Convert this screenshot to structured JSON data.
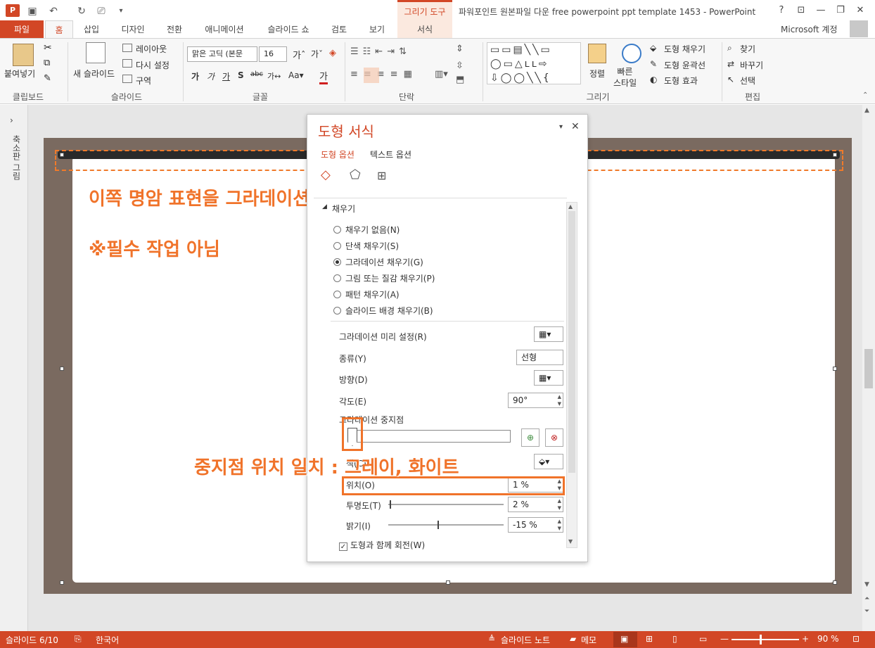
{
  "app": {
    "window_title": "파워포인트 원본파일 다운 free powerpoint ppt template 1453 - PowerPoint",
    "contextual_group": "그리기 도구",
    "account": "Microsoft 계정"
  },
  "tabs": [
    "파일",
    "홈",
    "삽입",
    "디자인",
    "전환",
    "애니메이션",
    "슬라이드 쇼",
    "검토",
    "보기",
    "서식"
  ],
  "ribbon": {
    "clipboard": {
      "paste": "붙여넣기",
      "group": "클립보드"
    },
    "slides": {
      "new_slide": "새 슬라이드",
      "layout": "레이아웃",
      "reset": "다시 설정",
      "section": "구역",
      "group": "슬라이드"
    },
    "font": {
      "font_name": "맑은 고딕 (본문",
      "font_size": "16",
      "group": "글꼴"
    },
    "paragraph": {
      "group": "단락"
    },
    "drawing": {
      "arrange": "정렬",
      "quick_styles": "빠른\n스타일",
      "fill": "도형 채우기",
      "outline": "도형 윤곽선",
      "effects": "도형 효과",
      "group": "그리기"
    },
    "editing": {
      "find": "찾기",
      "replace": "바꾸기",
      "select": "선택",
      "group": "편집"
    }
  },
  "left_pane": {
    "label": "축소판 그림"
  },
  "slide": {
    "annotation_1": "이쪽 명암 표현을 그라데이션 채색으로 처리",
    "annotation_2": "※필수 작업 아님",
    "annotation_3": "중지점 위치 일치 : 그레이, 화이트"
  },
  "format_pane": {
    "title": "도형 서식",
    "tab_shape": "도형 옵션",
    "tab_text": "텍스트 옵션",
    "section_fill": "채우기",
    "fill_options": [
      "채우기 없음(N)",
      "단색 채우기(S)",
      "그라데이션 채우기(G)",
      "그림 또는 질감 채우기(P)",
      "패턴 채우기(A)",
      "슬라이드 배경 채우기(B)"
    ],
    "selected_fill": 2,
    "preset_label": "그라데이션 미리 설정(R)",
    "type_label": "종류(Y)",
    "type_value": "선형",
    "direction_label": "방향(D)",
    "angle_label": "각도(E)",
    "angle_value": "90°",
    "stops_label": "그라데이션 중지점",
    "color_label": "색(C)",
    "position_label": "위치(O)",
    "position_value": "1 %",
    "transparency_label": "투명도(T)",
    "transparency_value": "2 %",
    "brightness_label": "밝기(I)",
    "brightness_value": "-15 %",
    "rotate_label": "도형과 함께 회전(W)"
  },
  "status": {
    "slide": "슬라이드 6/10",
    "language": "한국어",
    "notes": "슬라이드 노트",
    "comments": "메모",
    "zoom": "90 %"
  },
  "colors": {
    "accent": "#d24726",
    "annotation": "#f0732a",
    "slide_bg": "#7a6a60"
  }
}
